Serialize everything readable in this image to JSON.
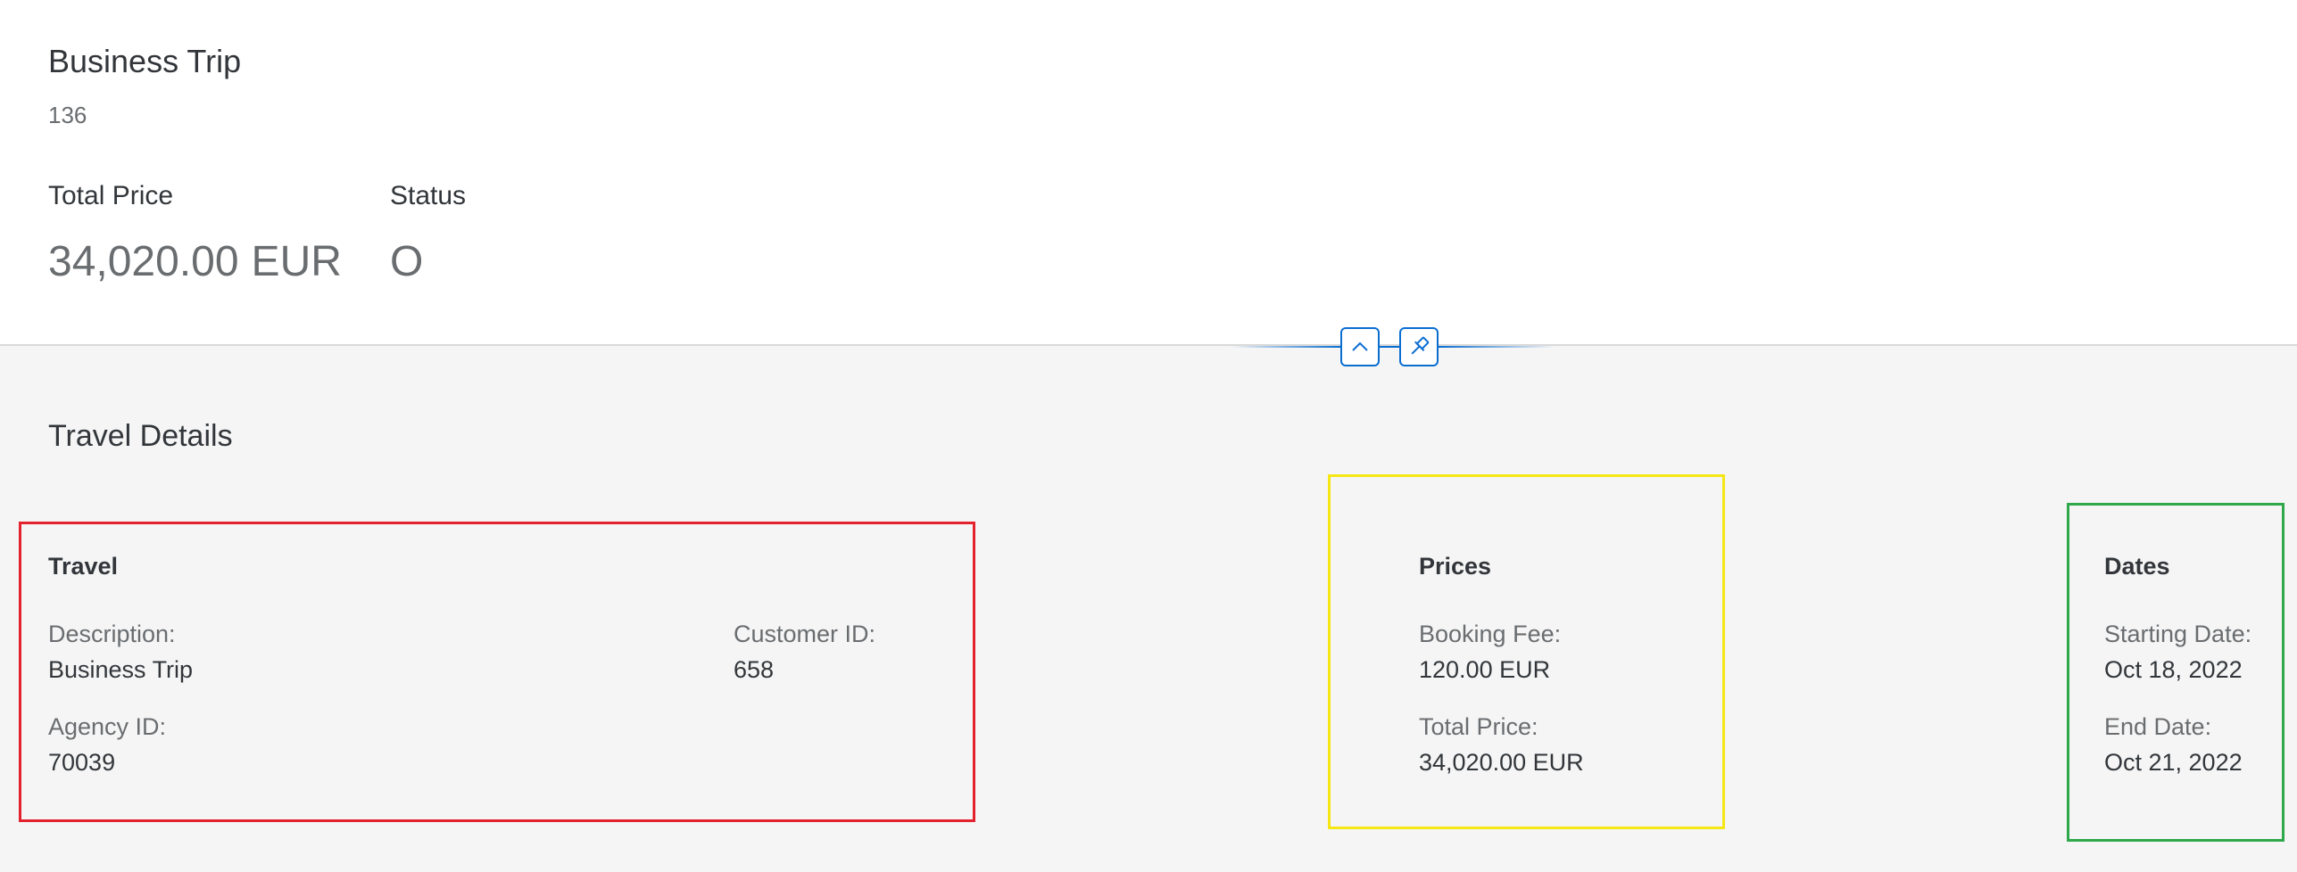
{
  "header": {
    "title": "Business Trip",
    "subtitle": "136",
    "kpis": [
      {
        "label": "Total Price",
        "value": "34,020.00",
        "unit": "EUR"
      },
      {
        "label": "Status",
        "value": "O"
      }
    ],
    "collapse_icon": "chevron-up-icon",
    "pin_icon": "pin-icon",
    "accent_color": "#0a6ed1"
  },
  "section": {
    "title": "Travel Details"
  },
  "groups": {
    "travel": {
      "title": "Travel",
      "border_color": "#e3222e",
      "fields": [
        {
          "label": "Description:",
          "value": "Business Trip"
        },
        {
          "label": "Customer ID:",
          "value": "658"
        },
        {
          "label": "Agency ID:",
          "value": "70039"
        }
      ]
    },
    "prices": {
      "title": "Prices",
      "border_color": "#f5e614",
      "fields": [
        {
          "label": "Booking Fee:",
          "value": "120.00 EUR"
        },
        {
          "label": "Total Price:",
          "value": "34,020.00 EUR"
        }
      ]
    },
    "dates": {
      "title": "Dates",
      "border_color": "#2ea84a",
      "fields": [
        {
          "label": "Starting Date:",
          "value": "Oct 18, 2022"
        },
        {
          "label": "End Date:",
          "value": "Oct 21, 2022"
        }
      ]
    }
  }
}
